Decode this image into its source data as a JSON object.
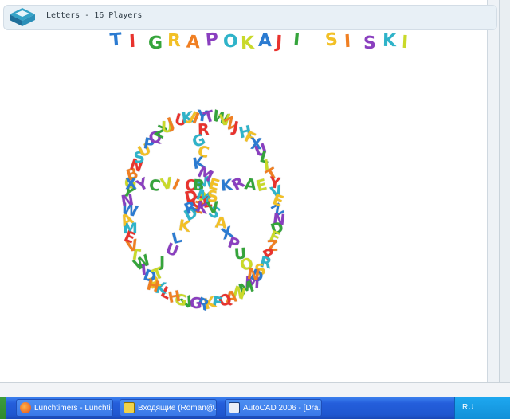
{
  "header": {
    "title": "Letters - 16 Players"
  },
  "title_words": [
    {
      "letters": [
        "T",
        "I",
        "G",
        "R",
        "A"
      ]
    },
    {
      "letters": [
        "P",
        "O",
        "K",
        "A",
        "J",
        "I"
      ]
    },
    {
      "letters": [
        "S",
        "I",
        "S",
        "K",
        "I"
      ]
    }
  ],
  "magnet_colors": [
    "#2b7bd1",
    "#e8332e",
    "#35a43b",
    "#f2c026",
    "#f07f22",
    "#8a3fbf",
    "#2fb3c9",
    "#c9d92a"
  ],
  "magnet_letters": "ZNDEZPRSDMMNAQFKRGVGHLKRDTWTVEMAWNYGBNSUPQZUJUKJYTWVZJHFXULITYVEXYCVIOMEKRAEIRGCKMBAZGDKLUJTHESAXPUONDMSRKVLKWNEQUZRMYCOBZ",
  "taskbar": {
    "buttons": [
      {
        "label": "Lunchtimers - Lunchti..."
      },
      {
        "label": "Входящие (Roman@..."
      },
      {
        "label": "AutoCAD 2006 - [Dra..."
      }
    ],
    "tray_lang": "RU"
  }
}
